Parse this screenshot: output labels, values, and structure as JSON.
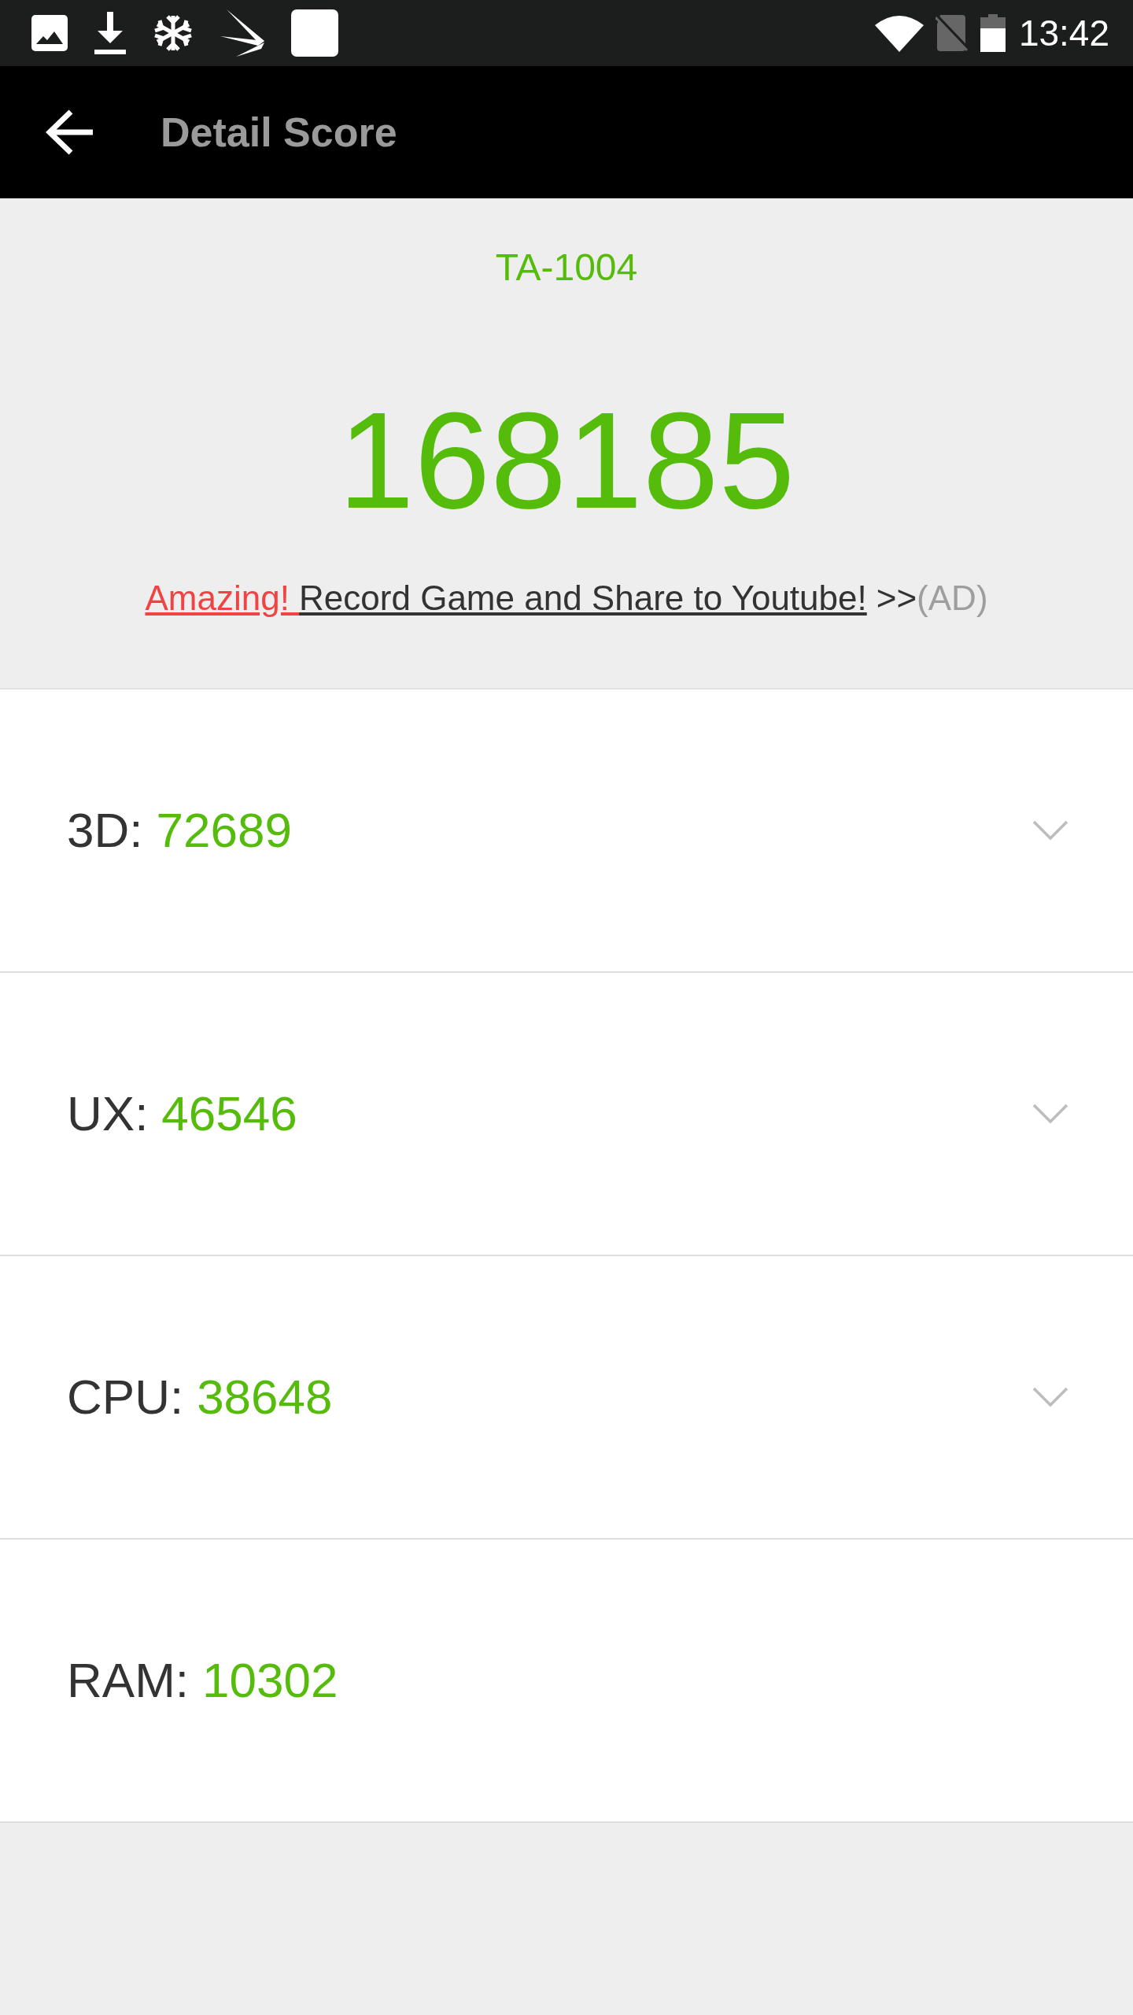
{
  "status_bar": {
    "time": "13:42"
  },
  "toolbar": {
    "title": "Detail Score"
  },
  "summary": {
    "device": "TA-1004",
    "total_score": "168185",
    "ad": {
      "highlight": "Amazing!",
      "link_text": "Record Game and Share to Youtube!",
      "arrows": ">>",
      "tag": "(AD)"
    }
  },
  "scores": [
    {
      "label": "3D:",
      "value": "72689",
      "expandable": true
    },
    {
      "label": "UX:",
      "value": "46546",
      "expandable": true
    },
    {
      "label": "CPU:",
      "value": "38648",
      "expandable": true
    },
    {
      "label": "RAM:",
      "value": "10302",
      "expandable": false
    }
  ]
}
